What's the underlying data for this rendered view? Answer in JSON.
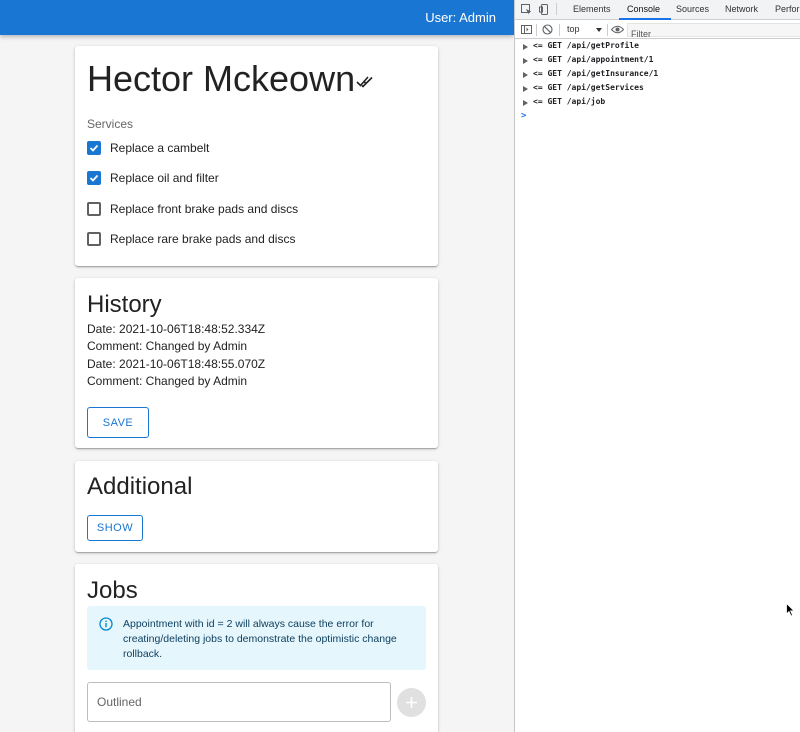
{
  "appbar": {
    "user_label": "User: Admin"
  },
  "profile": {
    "name": "Hector Mckeown",
    "status_icon": "done-all-icon",
    "services_label": "Services",
    "services": [
      {
        "label": "Replace a cambelt",
        "checked": true
      },
      {
        "label": "Replace oil and filter",
        "checked": true
      },
      {
        "label": "Replace front brake pads and discs",
        "checked": false
      },
      {
        "label": "Replace rare brake pads and discs",
        "checked": false
      }
    ]
  },
  "history": {
    "title": "History",
    "lines": [
      "Date: 2021-10-06T18:48:52.334Z",
      "Comment: Changed by Admin",
      "Date: 2021-10-06T18:48:55.070Z",
      "Comment: Changed by Admin"
    ],
    "save_label": "SAVE"
  },
  "additional": {
    "title": "Additional",
    "show_label": "SHOW"
  },
  "jobs": {
    "title": "Jobs",
    "alert_text": "Appointment with id = 2 will always cause the error for creating/deleting jobs to demonstrate the optimistic change rollback.",
    "input_placeholder": "Outlined",
    "input_value": ""
  },
  "devtools": {
    "tabs": [
      "Elements",
      "Console",
      "Sources",
      "Network",
      "Perform"
    ],
    "active_tab": "Console",
    "context": "top",
    "filter_placeholder": "Filter",
    "logs": [
      "<= GET /api/getProfile",
      "<= GET /api/appointment/1",
      "<= GET /api/getInsurance/1",
      "<= GET /api/getServices",
      "<= GET /api/job"
    ],
    "prompt": ">"
  },
  "colors": {
    "primary": "#1976d2",
    "info_bg": "#e5f6fd",
    "devtools_accent": "#1a73e8"
  }
}
